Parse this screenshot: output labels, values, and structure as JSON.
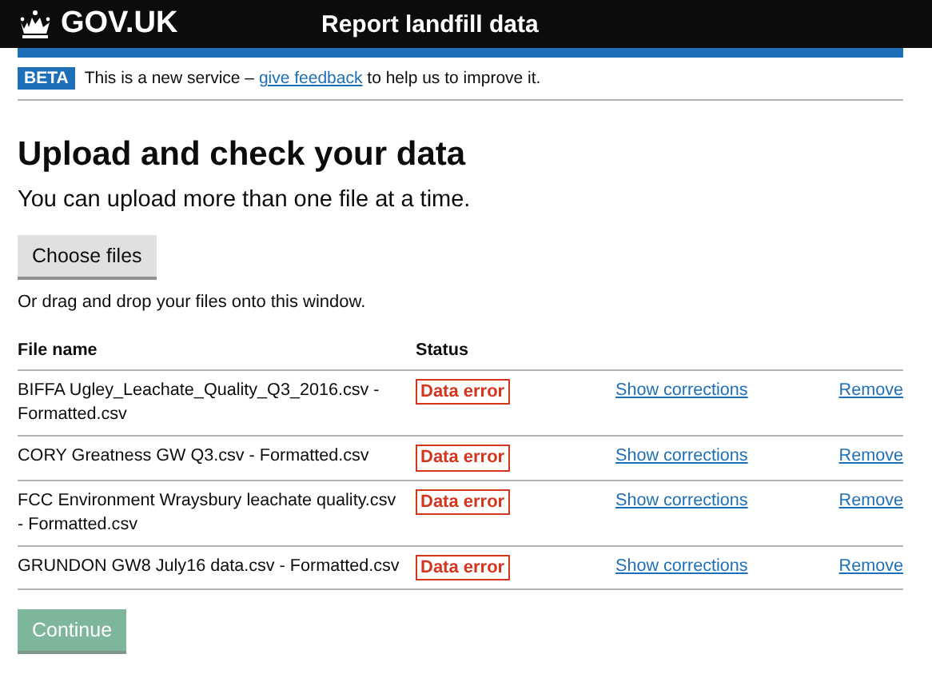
{
  "header": {
    "logo": "GOV.UK",
    "service": "Report landfill data"
  },
  "phase_banner": {
    "tag": "BETA",
    "before": "This is a new service – ",
    "link": "give feedback",
    "after": " to help us to improve it."
  },
  "heading": "Upload and check your data",
  "lead": "You can upload more than one file at a time.",
  "upload_button": "Choose files",
  "hint": "Or drag and drop your files onto this window.",
  "table": {
    "columns": [
      "File name",
      "Status"
    ],
    "rows": [
      {
        "file": "BIFFA Ugley_Leachate_Quality_Q3_2016.csv - Formatted.csv",
        "status": {
          "label": "Data error",
          "kind": "error"
        },
        "action": "Show corrections",
        "remove": "Remove"
      },
      {
        "file": "CORY Greatness GW Q3.csv - Formatted.csv",
        "status": {
          "label": "Data error",
          "kind": "error"
        },
        "action": "Show corrections",
        "remove": "Remove"
      },
      {
        "file": "FCC Environment Wraysbury leachate quality.csv - Formatted.csv",
        "status": {
          "label": "Data error",
          "kind": "error"
        },
        "action": "Show corrections",
        "remove": "Remove"
      },
      {
        "file": "GRUNDON GW8 July16 data.csv - Formatted.csv",
        "status": {
          "label": "Data error",
          "kind": "error"
        },
        "action": "Show corrections",
        "remove": "Remove"
      }
    ]
  },
  "continue_button": {
    "label": "Continue",
    "disabled": true
  }
}
